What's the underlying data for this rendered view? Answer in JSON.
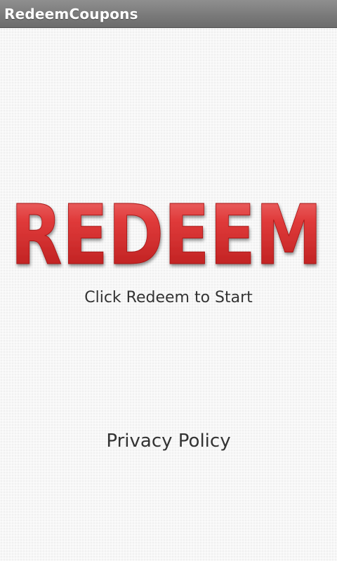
{
  "app": {
    "title": "RedeemCoupons"
  },
  "main": {
    "logo_text": "REDEEM",
    "instruction": "Click Redeem to Start",
    "privacy_link": "Privacy Policy"
  },
  "colors": {
    "title_bar": "#7a7a7a",
    "logo_red": "#d72a2a",
    "text": "#333333"
  }
}
